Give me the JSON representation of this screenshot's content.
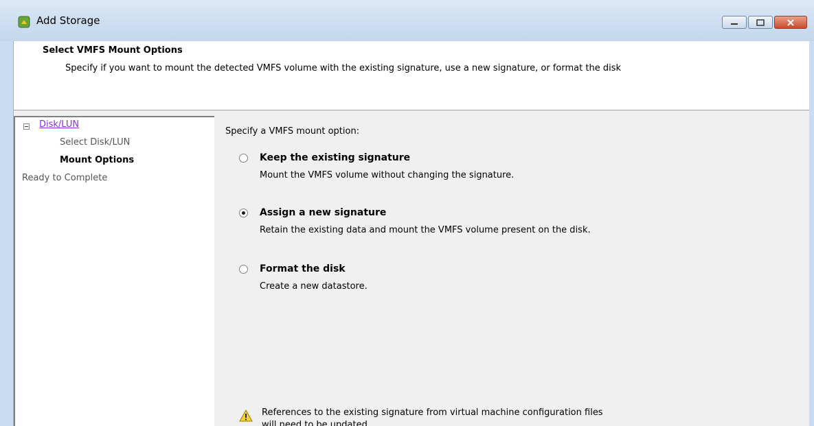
{
  "window": {
    "title": "Add Storage",
    "icon": "add-storage-icon"
  },
  "header": {
    "title": "Select VMFS Mount Options",
    "subtitle": "Specify if you want to mount the detected VMFS volume with the existing signature, use a new signature, or format the disk"
  },
  "nav": {
    "group": "Disk/LUN",
    "items": [
      {
        "label": "Select Disk/LUN",
        "state": "completed"
      },
      {
        "label": "Mount Options",
        "state": "current"
      },
      {
        "label": "Ready to Complete",
        "state": "pending"
      }
    ]
  },
  "content": {
    "prompt": "Specify a VMFS mount option:",
    "options": [
      {
        "label": "Keep the existing signature",
        "description": "Mount the VMFS volume without changing the signature.",
        "selected": false
      },
      {
        "label": "Assign a new signature",
        "description": "Retain the existing data and mount the VMFS volume present on the disk.",
        "selected": true
      },
      {
        "label": "Format the disk",
        "description": "Create a new datastore.",
        "selected": false
      }
    ],
    "warning": "References to the existing signature from virtual machine configuration files will need to be updated."
  },
  "colors": {
    "link": "#8a2be2",
    "titlebar": "#c9dcf0",
    "close": "#c84a2b"
  }
}
